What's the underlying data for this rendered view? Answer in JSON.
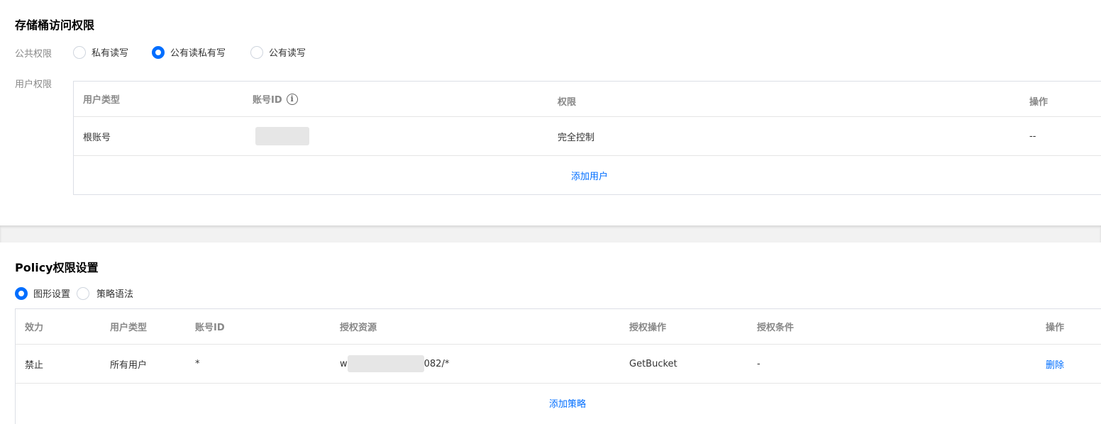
{
  "bucket_acl": {
    "title": "存储桶访问权限",
    "public_label": "公共权限",
    "public_options": [
      {
        "label": "私有读写",
        "checked": false
      },
      {
        "label": "公有读私有写",
        "checked": true
      },
      {
        "label": "公有读写",
        "checked": false
      }
    ],
    "user_label": "用户权限",
    "table": {
      "headers": {
        "user_type": "用户类型",
        "account_id": "账号ID",
        "permission": "权限",
        "operation": "操作"
      },
      "rows": [
        {
          "user_type": "根账号",
          "account_id": "",
          "permission": "完全控制",
          "operation": "--"
        }
      ],
      "add_link": "添加用户"
    }
  },
  "policy": {
    "title": "Policy权限设置",
    "mode_options": [
      {
        "label": "图形设置",
        "checked": true
      },
      {
        "label": "策略语法",
        "checked": false
      }
    ],
    "table": {
      "headers": {
        "effect": "效力",
        "user_type": "用户类型",
        "account_id": "账号ID",
        "resource": "授权资源",
        "action": "授权操作",
        "condition": "授权条件",
        "operation": "操作"
      },
      "rows": [
        {
          "effect": "禁止",
          "user_type": "所有用户",
          "account_id": "*",
          "resource_prefix": "w",
          "resource_suffix": "082/*",
          "action": "GetBucket",
          "condition": "-",
          "operation": "删除"
        }
      ],
      "add_link": "添加策略"
    }
  },
  "colors": {
    "accent": "#006eff",
    "label_gray": "#888888",
    "border": "#dcdfe6"
  }
}
